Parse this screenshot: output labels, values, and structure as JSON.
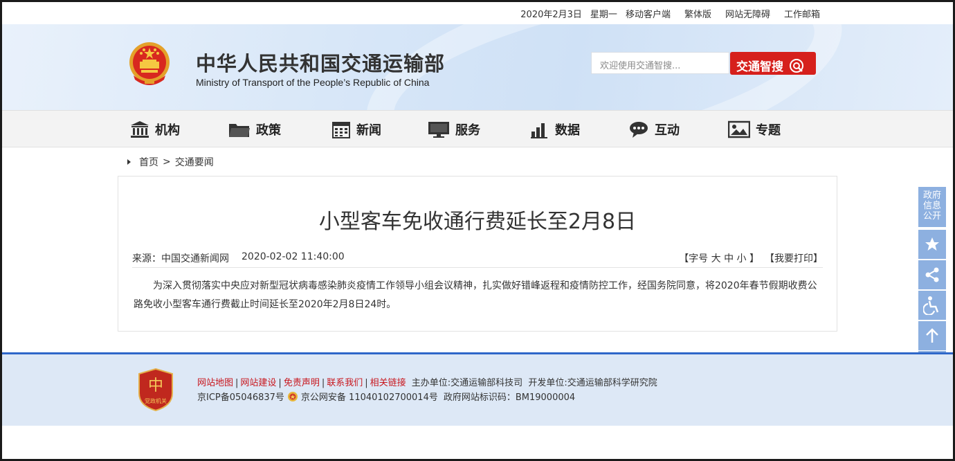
{
  "topbar": {
    "date": "2020年2月3日",
    "weekday": "星期一",
    "mobile": "移动客户端",
    "traditional": "繁体版",
    "accessibility": "网站无障碍",
    "mailbox": "工作邮箱"
  },
  "header": {
    "title": "中华人民共和国交通运输部",
    "subtitle": "Ministry of Transport of the People’s Republic of China",
    "search_placeholder": "欢迎使用交通智搜...",
    "search_button": "交通智搜"
  },
  "nav": {
    "items": [
      {
        "label": "机构",
        "icon": "institution-icon"
      },
      {
        "label": "政策",
        "icon": "folder-icon"
      },
      {
        "label": "新闻",
        "icon": "calendar-icon"
      },
      {
        "label": "服务",
        "icon": "monitor-icon"
      },
      {
        "label": "数据",
        "icon": "bar-chart-icon"
      },
      {
        "label": "互动",
        "icon": "chat-icon"
      },
      {
        "label": "专题",
        "icon": "image-icon"
      }
    ]
  },
  "breadcrumb": {
    "home": "首页",
    "separator": ">",
    "current": "交通要闻"
  },
  "article": {
    "title": "小型客车免收通行费延长至2月8日",
    "source": "来源：中国交通新闻网",
    "datetime": "2020-02-02 11:40:00",
    "font_size_prefix": "【字号",
    "size_large": "大",
    "size_medium": "中",
    "size_small": "小",
    "font_size_suffix": "】",
    "print": "【我要打印】",
    "body": "为深入贯彻落实中央应对新型冠状病毒感染肺炎疫情工作领导小组会议精神，扎实做好错峰返程和疫情防控工作，经国务院同意，将2020年春节假期收费公路免收小型客车通行费截止时间延长至2020年2月8日24时。"
  },
  "footer": {
    "links": [
      "网站地图",
      "网站建设",
      "免责声明",
      "联系我们",
      "相关链接"
    ],
    "sponsor": "主办单位:交通运输部科技司",
    "developer": "开发单位:交通运输部科学研究院",
    "icp": "京ICP备05046837号",
    "police": "京公网安备 11040102700014号",
    "gov_id": "政府网站标识码：BM19000004",
    "party_badge": "党政机关"
  },
  "sidebar": {
    "gov_info": [
      "政府",
      "信息",
      "公开"
    ],
    "buttons": [
      "star-icon",
      "share-icon",
      "accessibility-icon",
      "arrow-up-icon"
    ],
    "close": "✕"
  },
  "colors": {
    "accent_red": "#d6201c",
    "footer_blue": "#2e67c9",
    "side_blue": "#8db0e0"
  }
}
